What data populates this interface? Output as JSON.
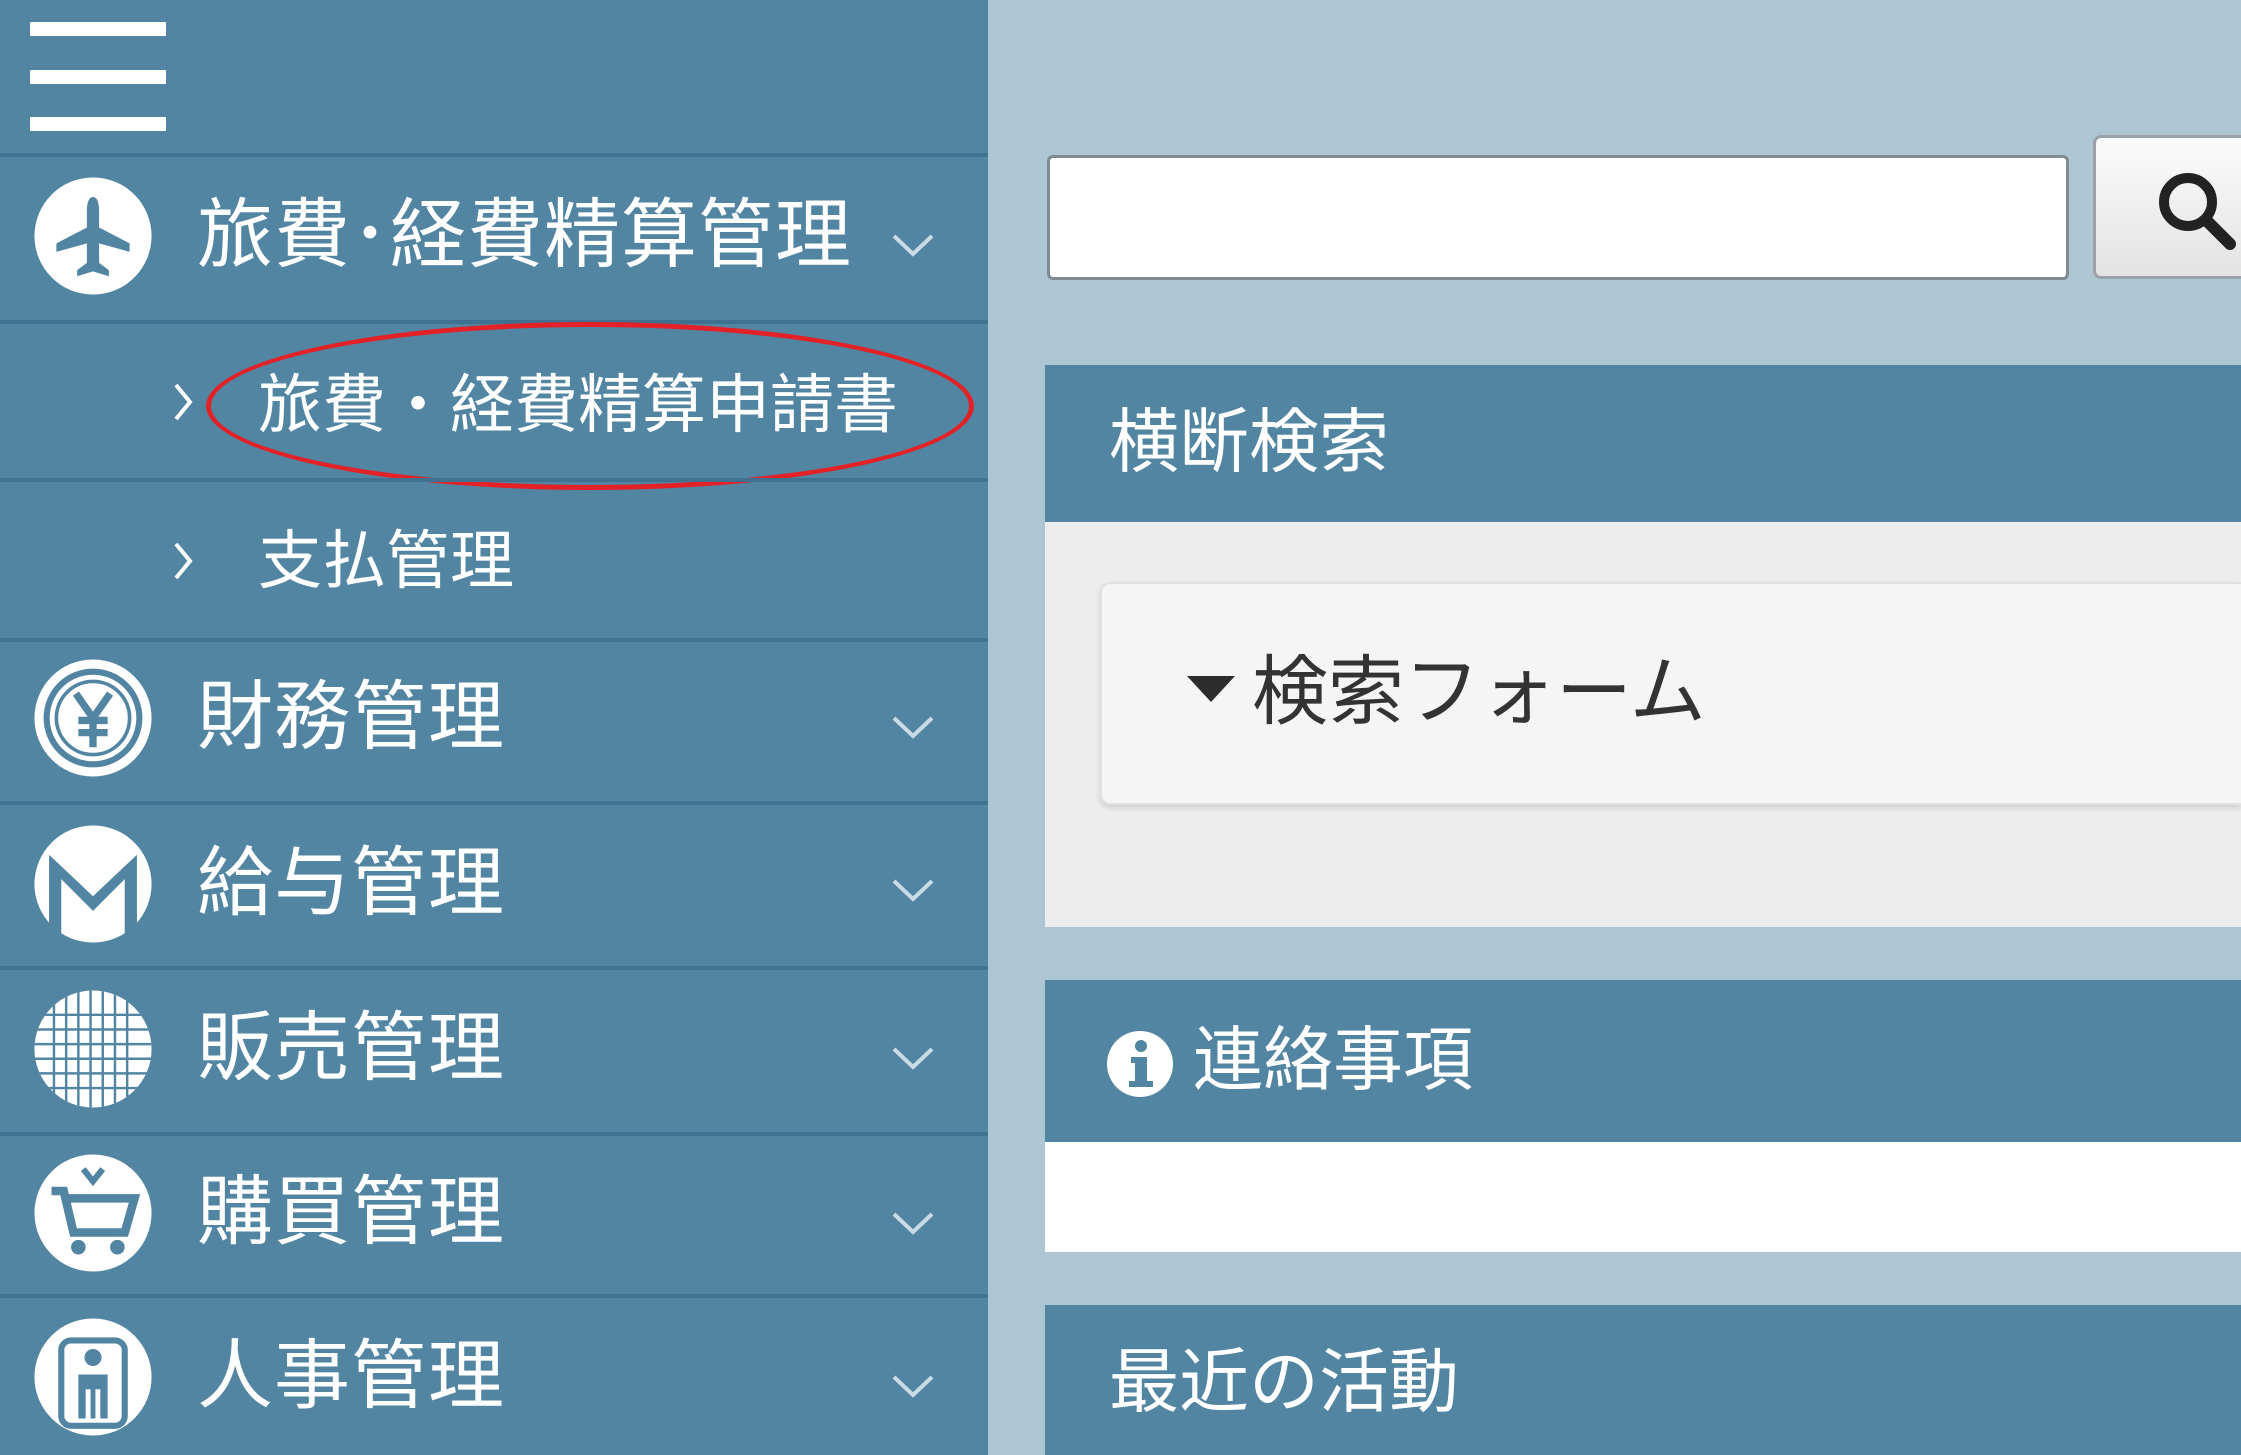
{
  "sidebar": {
    "items": [
      {
        "label": "旅費･経費精算管理",
        "icon": "airplane-icon"
      },
      {
        "label": "財務管理",
        "icon": "yen-coin-icon"
      },
      {
        "label": "給与管理",
        "icon": "envelope-icon"
      },
      {
        "label": "販売管理",
        "icon": "grid-building-icon"
      },
      {
        "label": "購買管理",
        "icon": "shopping-cart-icon"
      },
      {
        "label": "人事管理",
        "icon": "person-icon"
      }
    ],
    "subitems": [
      {
        "label": "旅費・経費精算申請書",
        "highlighted": true
      },
      {
        "label": "支払管理"
      }
    ]
  },
  "search": {
    "value": "",
    "button_icon": "search-icon"
  },
  "panels": {
    "cross_search": {
      "title": "横断検索",
      "form_label": "検索フォーム"
    },
    "notices": {
      "title": "連絡事項",
      "icon": "info-icon"
    },
    "recent": {
      "title": "最近の活動"
    }
  },
  "colors": {
    "sidebar_bg": "#5285a2",
    "main_bg": "#aec5d3",
    "highlight_oval": "#e32127"
  }
}
